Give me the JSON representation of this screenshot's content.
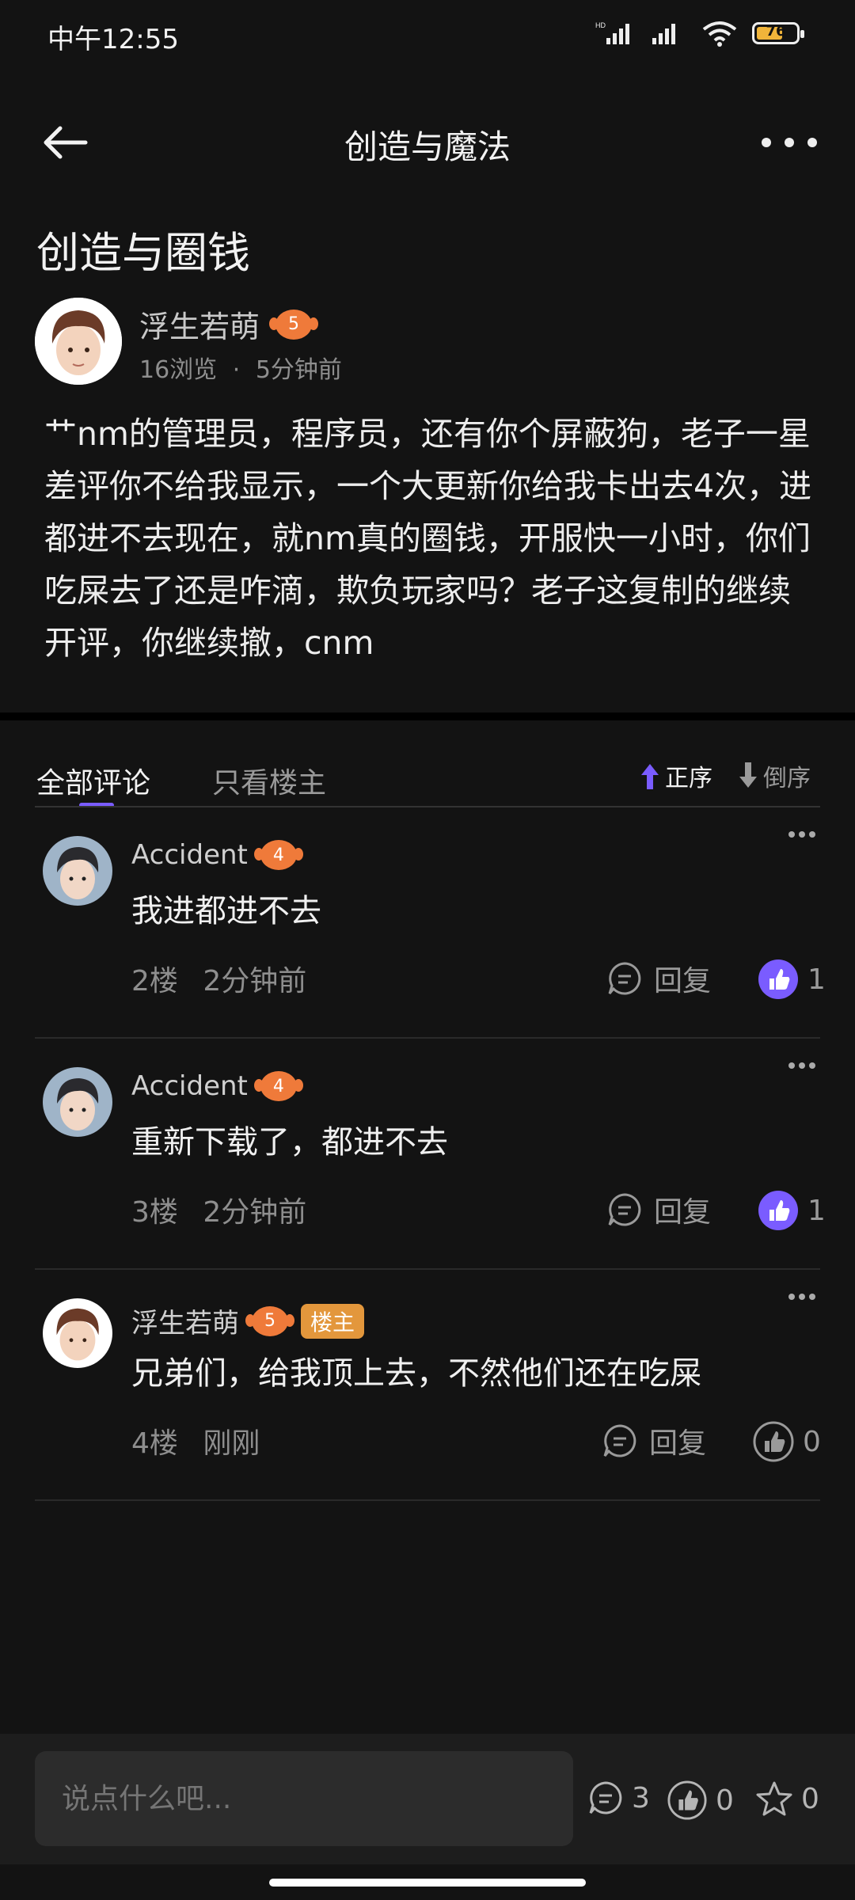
{
  "status_bar": {
    "time": "中午12:55",
    "battery": "76"
  },
  "header": {
    "title": "创造与魔法"
  },
  "post": {
    "title": "创造与圈钱",
    "author": "浮生若萌",
    "author_level": "5",
    "views": "16浏览",
    "separator": "·",
    "time": "5分钟前",
    "body": "艹nm的管理员，程序员，还有你个屏蔽狗，老子一星差评你不给我显示，一个大更新你给我卡出去4次，进都进不去现在，就nm真的圈钱，开服快一小时，你们吃屎去了还是咋滴，欺负玩家吗？老子这复制的继续开评，你继续撤，cnm"
  },
  "tabs": {
    "all": "全部评论",
    "owner_only": "只看楼主",
    "asc": "正序",
    "desc": "倒序"
  },
  "comments": [
    {
      "name": "Accident",
      "level": "4",
      "text": "我进都进不去",
      "floor": "2楼",
      "time": "2分钟前",
      "reply": "回复",
      "likes": "1",
      "is_owner": false
    },
    {
      "name": "Accident",
      "level": "4",
      "text": "重新下载了，都进不去",
      "floor": "3楼",
      "time": "2分钟前",
      "reply": "回复",
      "likes": "1",
      "is_owner": false
    },
    {
      "name": "浮生若萌",
      "level": "5",
      "owner_tag": "楼主",
      "text": "兄弟们，给我顶上去，不然他们还在吃屎",
      "floor": "4楼",
      "time": "刚刚",
      "reply": "回复",
      "likes": "0",
      "is_owner": true
    }
  ],
  "bottom_bar": {
    "placeholder": "说点什么吧...",
    "comment_count": "3",
    "like_count": "0",
    "star_count": "0"
  },
  "colors": {
    "accent": "#7a5cff",
    "badge": "#ef7a3a",
    "owner_tag": "#e3973c"
  }
}
